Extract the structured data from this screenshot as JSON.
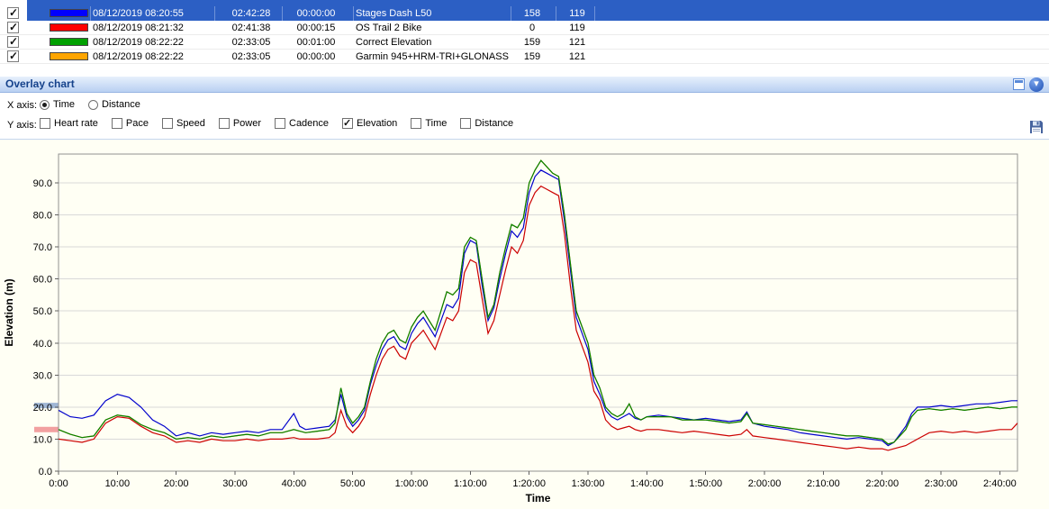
{
  "table": {
    "rows": [
      {
        "checked": true,
        "selected": true,
        "color": "#0000ff",
        "datetime": "08/12/2019 08:20:55",
        "duration": "02:42:28",
        "offset": "00:00:00",
        "name": "Stages Dash L50",
        "num1": "158",
        "num2": "119"
      },
      {
        "checked": true,
        "selected": false,
        "color": "#ff0000",
        "datetime": "08/12/2019 08:21:32",
        "duration": "02:41:38",
        "offset": "00:00:15",
        "name": "OS Trail 2 Bike",
        "num1": "0",
        "num2": "119"
      },
      {
        "checked": true,
        "selected": false,
        "color": "#00a000",
        "datetime": "08/12/2019 08:22:22",
        "duration": "02:33:05",
        "offset": "00:01:00",
        "name": "Correct Elevation",
        "num1": "159",
        "num2": "121"
      },
      {
        "checked": true,
        "selected": false,
        "color": "#ffa500",
        "datetime": "08/12/2019 08:22:22",
        "duration": "02:33:05",
        "offset": "00:00:00",
        "name": "Garmin 945+HRM-TRI+GLONASS",
        "num1": "159",
        "num2": "121"
      }
    ]
  },
  "overlay": {
    "title": "Overlay chart"
  },
  "controls": {
    "x_axis_label": "X axis:",
    "y_axis_label": "Y axis:",
    "x_options": [
      {
        "label": "Time",
        "selected": true
      },
      {
        "label": "Distance",
        "selected": false
      }
    ],
    "y_options": [
      {
        "label": "Heart rate",
        "checked": false
      },
      {
        "label": "Pace",
        "checked": false
      },
      {
        "label": "Speed",
        "checked": false
      },
      {
        "label": "Power",
        "checked": false
      },
      {
        "label": "Cadence",
        "checked": false
      },
      {
        "label": "Elevation",
        "checked": true
      },
      {
        "label": "Time",
        "checked": false
      },
      {
        "label": "Distance",
        "checked": false
      }
    ]
  },
  "chart_data": {
    "type": "line",
    "title": "",
    "xlabel": "Time",
    "ylabel": "Elevation (m)",
    "xlim": [
      0,
      163
    ],
    "ylim": [
      0,
      99
    ],
    "grid": "horizontal",
    "legend": "none",
    "colors": {
      "background": "#fffff4",
      "grid": "#d9d9d9",
      "axis": "#606060",
      "plot_border": "#909090"
    },
    "x_ticks": [
      {
        "minutes": 0,
        "label": "0:00"
      },
      {
        "minutes": 10,
        "label": "10:00"
      },
      {
        "minutes": 20,
        "label": "20:00"
      },
      {
        "minutes": 30,
        "label": "30:00"
      },
      {
        "minutes": 40,
        "label": "40:00"
      },
      {
        "minutes": 50,
        "label": "50:00"
      },
      {
        "minutes": 60,
        "label": "1:00:00"
      },
      {
        "minutes": 70,
        "label": "1:10:00"
      },
      {
        "minutes": 80,
        "label": "1:20:00"
      },
      {
        "minutes": 90,
        "label": "1:30:00"
      },
      {
        "minutes": 100,
        "label": "1:40:00"
      },
      {
        "minutes": 110,
        "label": "1:50:00"
      },
      {
        "minutes": 120,
        "label": "2:00:00"
      },
      {
        "minutes": 130,
        "label": "2:10:00"
      },
      {
        "minutes": 140,
        "label": "2:20:00"
      },
      {
        "minutes": 150,
        "label": "2:30:00"
      },
      {
        "minutes": 160,
        "label": "2:40:00"
      }
    ],
    "y_ticks": [
      {
        "value": 0,
        "label": "0.0"
      },
      {
        "value": 10,
        "label": "10.0"
      },
      {
        "value": 20,
        "label": "20.0"
      },
      {
        "value": 30,
        "label": "30.0"
      },
      {
        "value": 40,
        "label": "40.0"
      },
      {
        "value": 50,
        "label": "50.0"
      },
      {
        "value": 60,
        "label": "60.0"
      },
      {
        "value": 70,
        "label": "70.0"
      },
      {
        "value": 80,
        "label": "80.0"
      },
      {
        "value": 90,
        "label": "90.0"
      }
    ],
    "axis_markers": [
      {
        "value": 20.5,
        "color": "#9fb6d4"
      },
      {
        "value": 13,
        "color": "#f2a0a0"
      }
    ],
    "x": [
      0,
      2,
      4,
      6,
      8,
      10,
      12,
      14,
      16,
      18,
      20,
      22,
      24,
      26,
      28,
      30,
      32,
      34,
      36,
      38,
      40,
      41,
      42,
      44,
      46,
      47,
      48,
      49,
      50,
      51,
      52,
      53,
      54,
      55,
      56,
      57,
      58,
      59,
      60,
      61,
      62,
      63,
      64,
      65,
      66,
      67,
      68,
      69,
      70,
      71,
      72,
      73,
      74,
      75,
      76,
      77,
      78,
      79,
      80,
      81,
      82,
      83,
      84,
      85,
      86,
      87,
      88,
      89,
      90,
      91,
      92,
      93,
      94,
      95,
      96,
      97,
      98,
      99,
      100,
      102,
      104,
      106,
      108,
      110,
      112,
      114,
      116,
      117,
      118,
      120,
      122,
      124,
      126,
      128,
      130,
      132,
      134,
      136,
      138,
      140,
      141,
      142,
      144,
      145,
      146,
      148,
      150,
      152,
      154,
      156,
      158,
      160,
      162,
      163
    ],
    "series": [
      {
        "name": "Stages Dash L50",
        "color": "#0000cc",
        "values": [
          19,
          17,
          16.5,
          17.5,
          22,
          24,
          23,
          20,
          16,
          14,
          11,
          12,
          11,
          12,
          11.5,
          12,
          12.5,
          12,
          13,
          13,
          18,
          14,
          13,
          13.5,
          14,
          16,
          24,
          17,
          14,
          16,
          19,
          27,
          33,
          38,
          41,
          42,
          39,
          38,
          43,
          46,
          48,
          45,
          42,
          47,
          52,
          51,
          54,
          68,
          72,
          71,
          58,
          47,
          51,
          60,
          68,
          75,
          73,
          76,
          87,
          92,
          94,
          93,
          92,
          91,
          78,
          63,
          48,
          43,
          38,
          28,
          24,
          19,
          17,
          16,
          17,
          18,
          16.5,
          16,
          17,
          17.5,
          17,
          16.5,
          16,
          16.5,
          16,
          15.5,
          16,
          18.5,
          15,
          14,
          13.5,
          13,
          12,
          11.5,
          11,
          10.5,
          10,
          10.5,
          10,
          9.5,
          8,
          9,
          14,
          18,
          20,
          20,
          20.5,
          20,
          20.5,
          21,
          21,
          21.5,
          22,
          22
        ]
      },
      {
        "name": "OS Trail 2 Bike",
        "color": "#cc0000",
        "values": [
          10,
          9.5,
          9,
          10,
          15,
          17,
          16.5,
          14,
          12,
          11,
          9,
          9.5,
          9,
          10,
          9.5,
          9.5,
          10,
          9.5,
          10,
          10,
          10.5,
          10,
          10,
          10,
          10.5,
          12,
          19,
          14,
          12,
          14,
          17,
          24,
          30,
          35,
          38,
          39,
          36,
          35,
          40,
          42,
          44,
          41,
          38,
          43,
          48,
          47,
          50,
          62,
          66,
          65,
          54,
          43,
          47,
          55,
          63,
          70,
          68,
          72,
          83,
          87,
          89,
          88,
          87,
          86,
          74,
          58,
          44,
          39,
          34,
          25,
          22,
          16,
          14,
          13,
          13.5,
          14,
          13,
          12.5,
          13,
          13,
          12.5,
          12,
          12.5,
          12,
          11.5,
          11,
          11.5,
          13,
          11,
          10.5,
          10,
          9.5,
          9,
          8.5,
          8,
          7.5,
          7,
          7.5,
          7,
          7,
          6.5,
          7,
          8,
          9,
          10,
          12,
          12.5,
          12,
          12.5,
          12,
          12.5,
          13,
          13,
          15
        ]
      },
      {
        "name": "Garmin 945+HRM-TRI+GLONASS",
        "color": "#ff9900",
        "values": [
          13,
          11.5,
          10.5,
          11,
          16,
          17.5,
          17,
          14.5,
          13,
          12,
          10,
          10.5,
          10,
          11,
          10.5,
          11,
          11.5,
          11,
          12,
          12,
          13,
          12.5,
          12,
          12.5,
          13,
          15,
          26,
          18,
          15,
          17,
          20,
          28,
          35,
          40,
          43,
          44,
          41,
          40,
          45,
          48,
          50,
          47,
          44,
          50,
          56,
          55,
          57,
          70,
          73,
          72,
          60,
          48,
          52,
          62,
          70,
          77,
          76,
          79,
          90,
          94,
          97,
          95,
          93,
          92,
          80,
          65,
          50,
          45,
          40,
          30,
          26,
          20,
          18,
          17,
          18,
          21,
          17,
          16,
          17,
          17,
          17,
          16,
          16,
          16,
          15.5,
          15,
          15.5,
          18,
          15,
          14.5,
          14,
          13.5,
          13,
          12.5,
          12,
          11.5,
          11,
          11,
          10.5,
          10,
          8.5,
          9,
          13,
          17,
          19,
          19.5,
          19,
          19.5,
          19,
          19.5,
          20,
          19.5,
          20,
          20
        ]
      },
      {
        "name": "Correct Elevation",
        "color": "#008000",
        "values": [
          13,
          11.5,
          10.5,
          11,
          16,
          17.5,
          17,
          14.5,
          13,
          12,
          10,
          10.5,
          10,
          11,
          10.5,
          11,
          11.5,
          11,
          12,
          12,
          13,
          12.5,
          12,
          12.5,
          13,
          15,
          26,
          18,
          15,
          17,
          20,
          28,
          35,
          40,
          43,
          44,
          41,
          40,
          45,
          48,
          50,
          47,
          44,
          50,
          56,
          55,
          57,
          70,
          73,
          72,
          60,
          48,
          52,
          62,
          70,
          77,
          76,
          79,
          90,
          94,
          97,
          95,
          93,
          92,
          80,
          65,
          50,
          45,
          40,
          30,
          26,
          20,
          18,
          17,
          18,
          21,
          17,
          16,
          17,
          17,
          17,
          16,
          16,
          16,
          15.5,
          15,
          15.5,
          18,
          15,
          14.5,
          14,
          13.5,
          13,
          12.5,
          12,
          11.5,
          11,
          11,
          10.5,
          10,
          8.5,
          9,
          13,
          17,
          19,
          19.5,
          19,
          19.5,
          19,
          19.5,
          20,
          19.5,
          20,
          20
        ]
      }
    ]
  }
}
